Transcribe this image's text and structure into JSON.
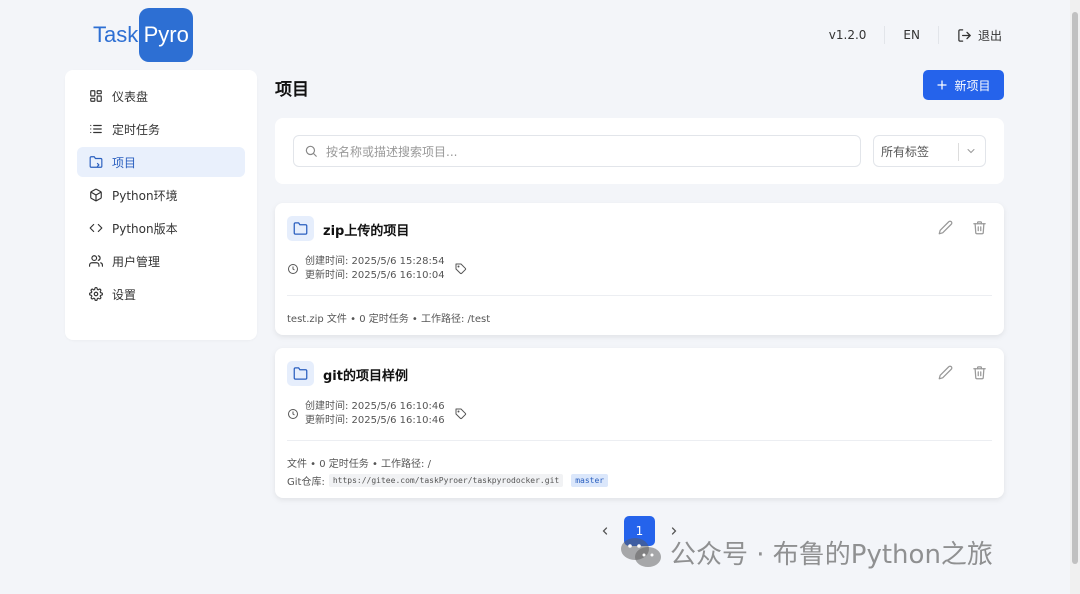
{
  "header": {
    "logo_part1": "Task",
    "logo_part2": "Pyro",
    "version": "v1.2.0",
    "language": "EN",
    "logout": "退出"
  },
  "sidebar": {
    "items": [
      {
        "label": "仪表盘",
        "icon": "dashboard-icon",
        "active": false
      },
      {
        "label": "定时任务",
        "icon": "list-icon",
        "active": false
      },
      {
        "label": "项目",
        "icon": "folder-icon",
        "active": true
      },
      {
        "label": "Python环境",
        "icon": "package-icon",
        "active": false
      },
      {
        "label": "Python版本",
        "icon": "code-icon",
        "active": false
      },
      {
        "label": "用户管理",
        "icon": "users-icon",
        "active": false
      },
      {
        "label": "设置",
        "icon": "gear-icon",
        "active": false
      }
    ]
  },
  "main": {
    "title": "项目",
    "new_button": "新项目",
    "search_placeholder": "按名称或描述搜索项目...",
    "tag_filter": "所有标签"
  },
  "projects": [
    {
      "name": "zip上传的项目",
      "created": "创建时间: 2025/5/6 15:28:54",
      "updated": "更新时间: 2025/5/6 16:10:04",
      "meta": "test.zip 文件 • 0 定时任务 • 工作路径: /test"
    },
    {
      "name": "git的项目样例",
      "created": "创建时间: 2025/5/6 16:10:46",
      "updated": "更新时间: 2025/5/6 16:10:46",
      "meta": "文件 • 0 定时任务 • 工作路径: /",
      "git_label": "Git仓库:",
      "git_url": "https://gitee.com/taskPyroer/taskpyrodocker.git",
      "git_branch": "master"
    }
  ],
  "pagination": {
    "current": "1"
  },
  "watermark": "公众号 · 布鲁的Python之旅",
  "colors": {
    "primary": "#2563eb",
    "logo": "#2d6fd3",
    "active_nav_bg": "#e9f0fc"
  }
}
